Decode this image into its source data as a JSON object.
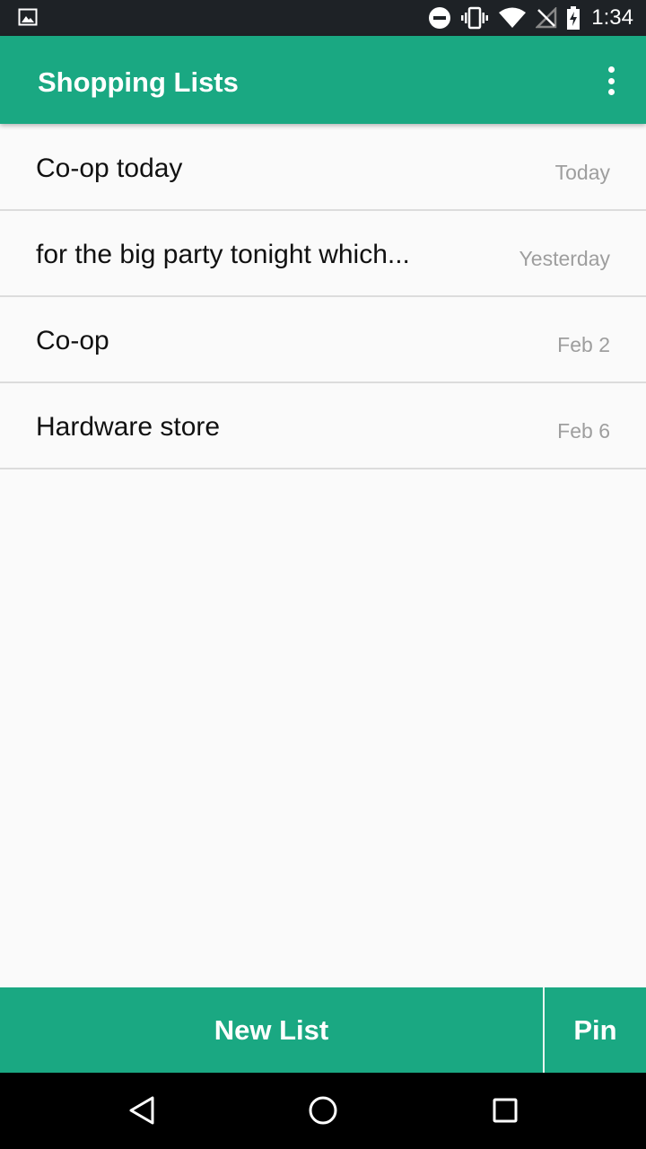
{
  "status_bar": {
    "time": "1:34",
    "icons": [
      "image-notification-icon",
      "do-not-disturb-icon",
      "vibrate-icon",
      "wifi-icon",
      "no-signal-icon",
      "battery-charging-icon"
    ]
  },
  "app_bar": {
    "title": "Shopping Lists",
    "menu_icon": "overflow-menu-icon"
  },
  "lists": [
    {
      "name": "Co-op today",
      "date": "Today"
    },
    {
      "name": "for the big party tonight which...",
      "date": "Yesterday"
    },
    {
      "name": "Co-op",
      "date": "Feb 2"
    },
    {
      "name": "Hardware store",
      "date": "Feb 6"
    }
  ],
  "bottom_bar": {
    "new_list_label": "New List",
    "pin_label": "Pin"
  },
  "nav_bar": {
    "icons": [
      "back-icon",
      "home-icon",
      "recents-icon"
    ]
  },
  "colors": {
    "accent": "#1aa882",
    "status_bar": "#1e2226",
    "nav_bar": "#000000",
    "date_text": "#9e9e9e"
  }
}
